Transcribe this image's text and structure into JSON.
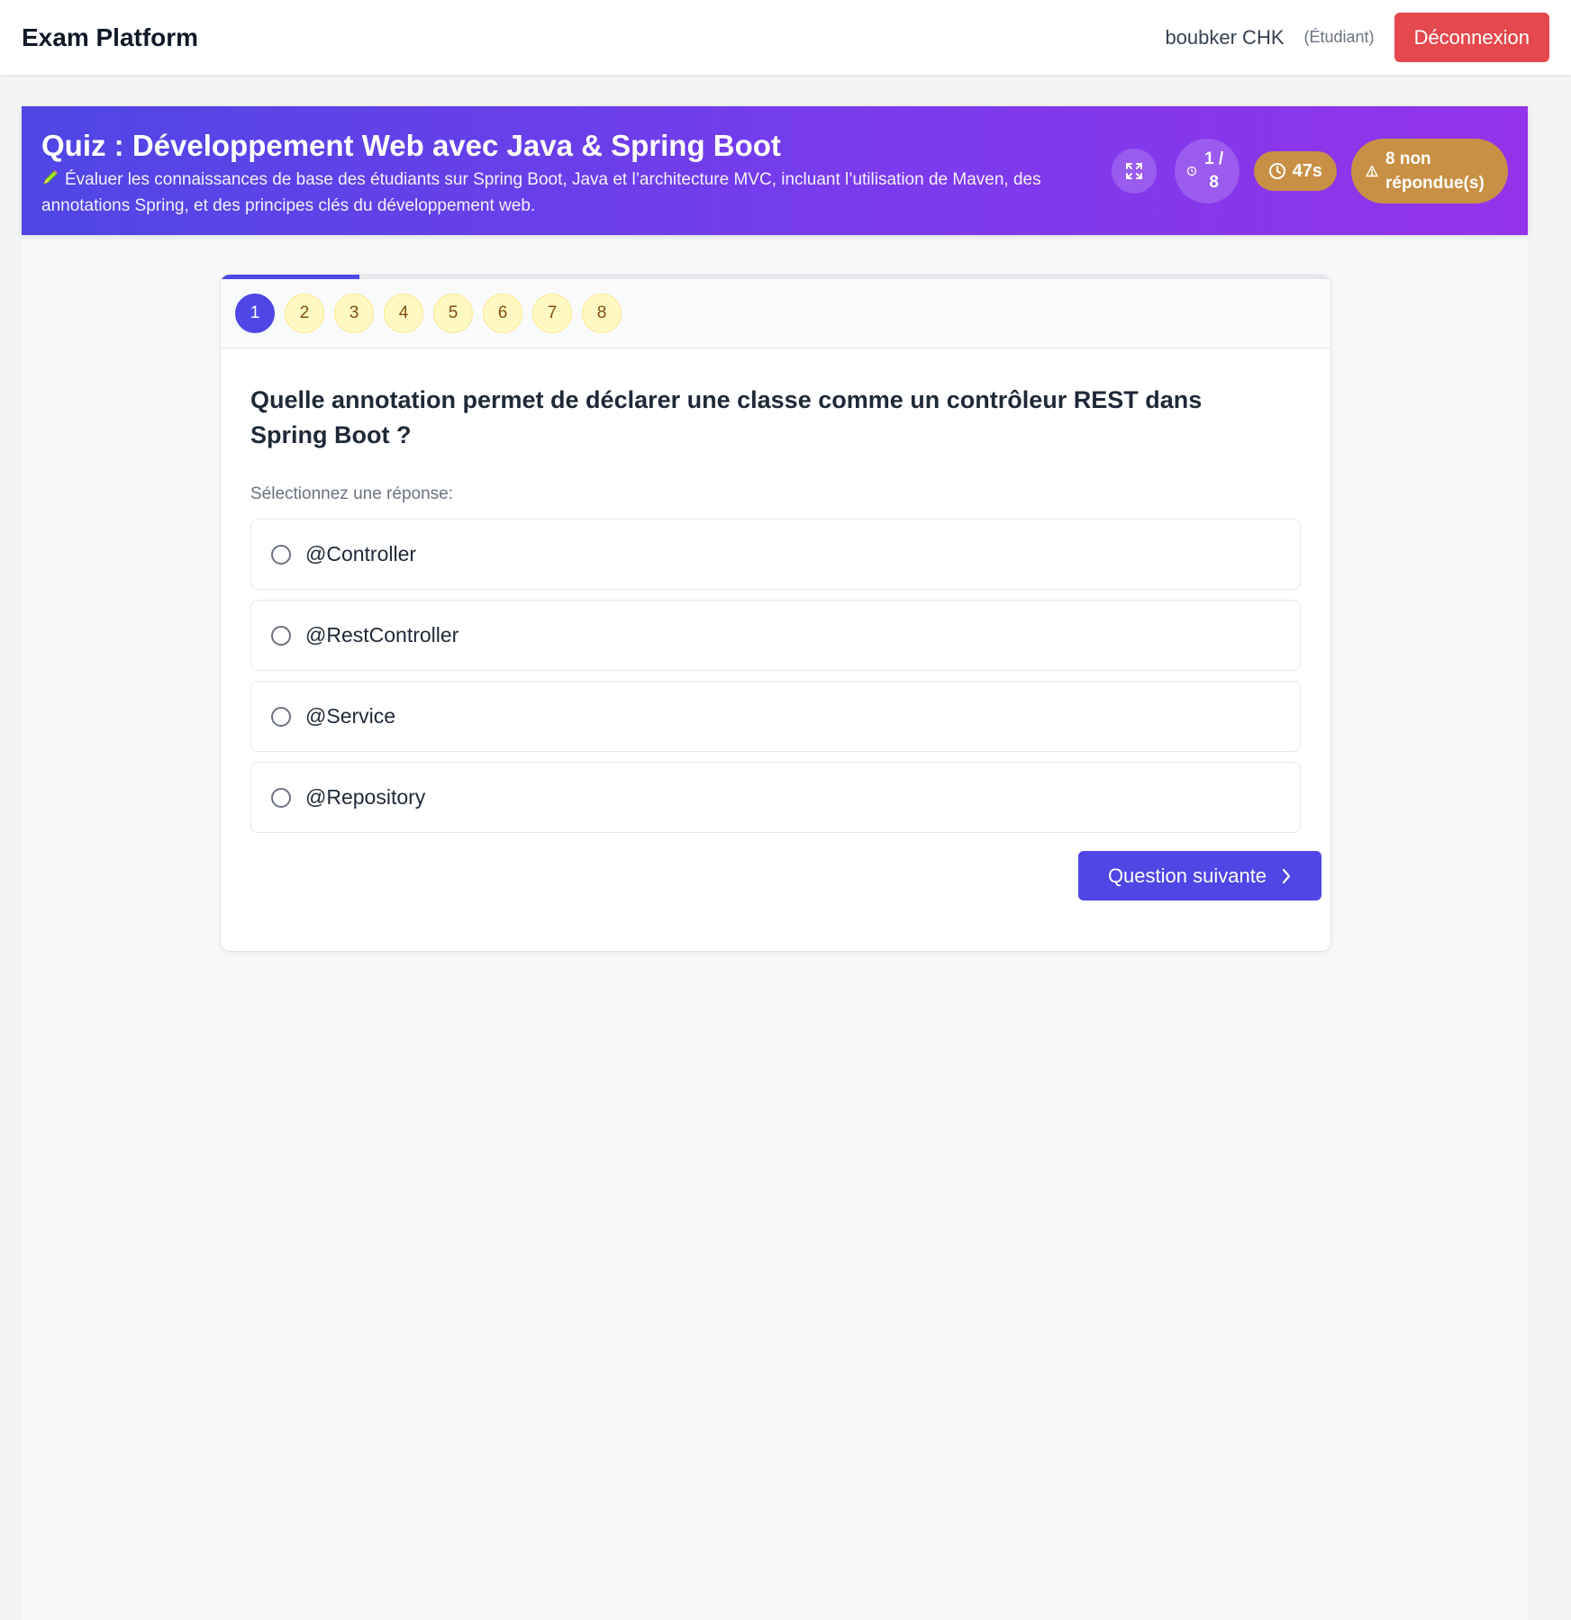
{
  "navbar": {
    "brand": "Exam Platform",
    "user_name": "boubker CHK",
    "user_role": "(Étudiant)",
    "logout_label": "Déconnexion"
  },
  "quiz": {
    "title": "Quiz : Développement Web avec Java & Spring Boot",
    "description": "Évaluer les connaissances de base des étudiants sur Spring Boot, Java et l’architecture MVC, incluant l’utilisation de Maven, des annotations Spring, et des principes clés du développement web.",
    "progress_label": "1 / 8",
    "timer_label": "47s",
    "unanswered_label": "8 non répondue(s)",
    "progress_fraction": 0.125
  },
  "question_nav": [
    "1",
    "2",
    "3",
    "4",
    "5",
    "6",
    "7",
    "8"
  ],
  "current_question": 1,
  "question": {
    "text": "Quelle annotation permet de déclarer une classe comme un contrôleur REST dans Spring Boot ?",
    "select_label": "Sélectionnez une réponse:",
    "options": [
      "@Controller",
      "@RestController",
      "@Service",
      "@Repository"
    ]
  },
  "next_label": "Question suivante",
  "colors": {
    "accent": "#4f46e5",
    "logout": "#e5484d",
    "badge": "#c89045",
    "unanswered_pill": "#fef9c3"
  }
}
